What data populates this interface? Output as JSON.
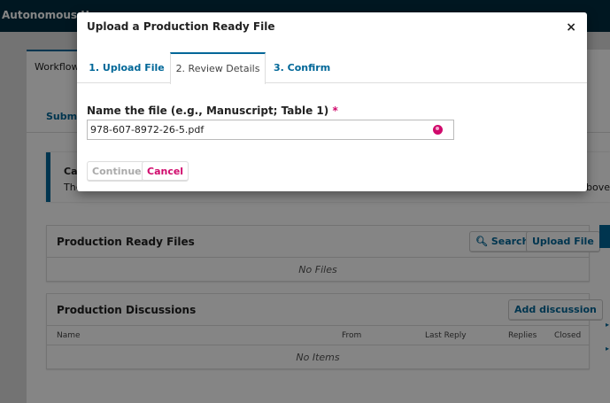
{
  "app": {
    "title": "Autonomous U"
  },
  "background": {
    "workflow_tab": "Workflow",
    "subnav_label": "Submi",
    "notice": {
      "title": "Cat",
      "text_left": "The",
      "text_right": "above"
    },
    "production_ready": {
      "title": "Production Ready Files",
      "search_label": "Search",
      "upload_label": "Upload File",
      "empty": "No Files"
    },
    "discussions": {
      "title": "Production Discussions",
      "add_label": "Add discussion",
      "columns": [
        "Name",
        "From",
        "Last Reply",
        "Replies",
        "Closed"
      ],
      "empty": "No Items"
    }
  },
  "modal": {
    "title": "Upload a Production Ready File",
    "close_glyph": "×",
    "tabs": [
      {
        "label": "1. Upload File",
        "state": "link"
      },
      {
        "label": "2. Review Details",
        "state": "active"
      },
      {
        "label": "3. Confirm",
        "state": "link"
      }
    ],
    "field_label": "Name the file (e.g., Manuscript; Table 1)",
    "required_mark": "*",
    "file_name_value": "978-607-8972-26-5.pdf",
    "locale_icon": "globe-icon",
    "continue_label": "Continue",
    "cancel_label": "Cancel"
  },
  "colors": {
    "brand": "#006798",
    "header": "#002c40",
    "accent": "#d00a6c"
  }
}
